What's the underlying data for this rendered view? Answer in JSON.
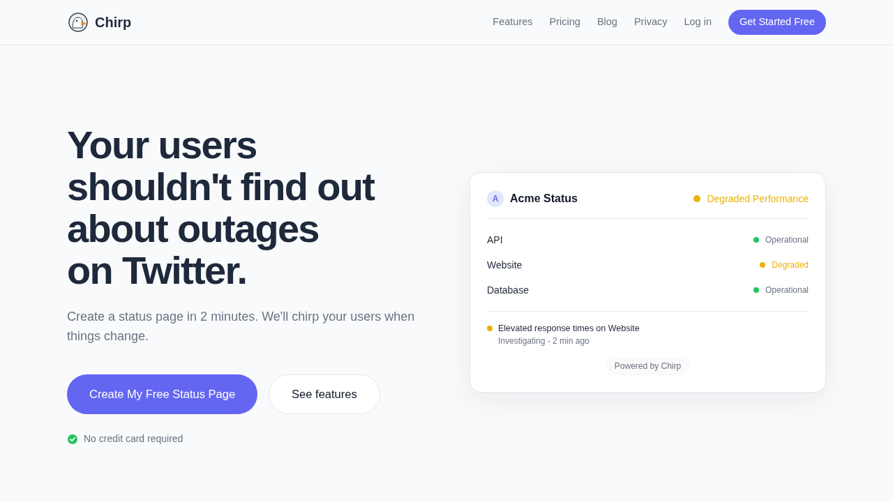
{
  "nav": {
    "brand": "Chirp",
    "links": [
      "Features",
      "Pricing",
      "Blog",
      "Privacy",
      "Log in"
    ],
    "cta": "Get Started Free"
  },
  "hero": {
    "headline": "Your users\nshouldn't find out\nabout outages\non Twitter.",
    "subtitle": "Create a status page in 2 minutes. We'll chirp your users when things change.",
    "primary_button": "Create My Free Status Page",
    "secondary_button": "See features",
    "note": "No credit card required"
  },
  "status_card": {
    "avatar_letter": "A",
    "title": "Acme Status",
    "overall": {
      "label": "Degraded Performance",
      "color": "#eab308"
    },
    "services": [
      {
        "name": "API",
        "status": "Operational",
        "kind": "operational",
        "color": "#22c55e"
      },
      {
        "name": "Website",
        "status": "Degraded",
        "kind": "degraded",
        "color": "#eab308"
      },
      {
        "name": "Database",
        "status": "Operational",
        "kind": "operational",
        "color": "#22c55e"
      }
    ],
    "incident": {
      "title": "Elevated response times on Website",
      "detail": "Investigating - 2 min ago",
      "color": "#eab308"
    },
    "footer": "Powered by Chirp"
  }
}
